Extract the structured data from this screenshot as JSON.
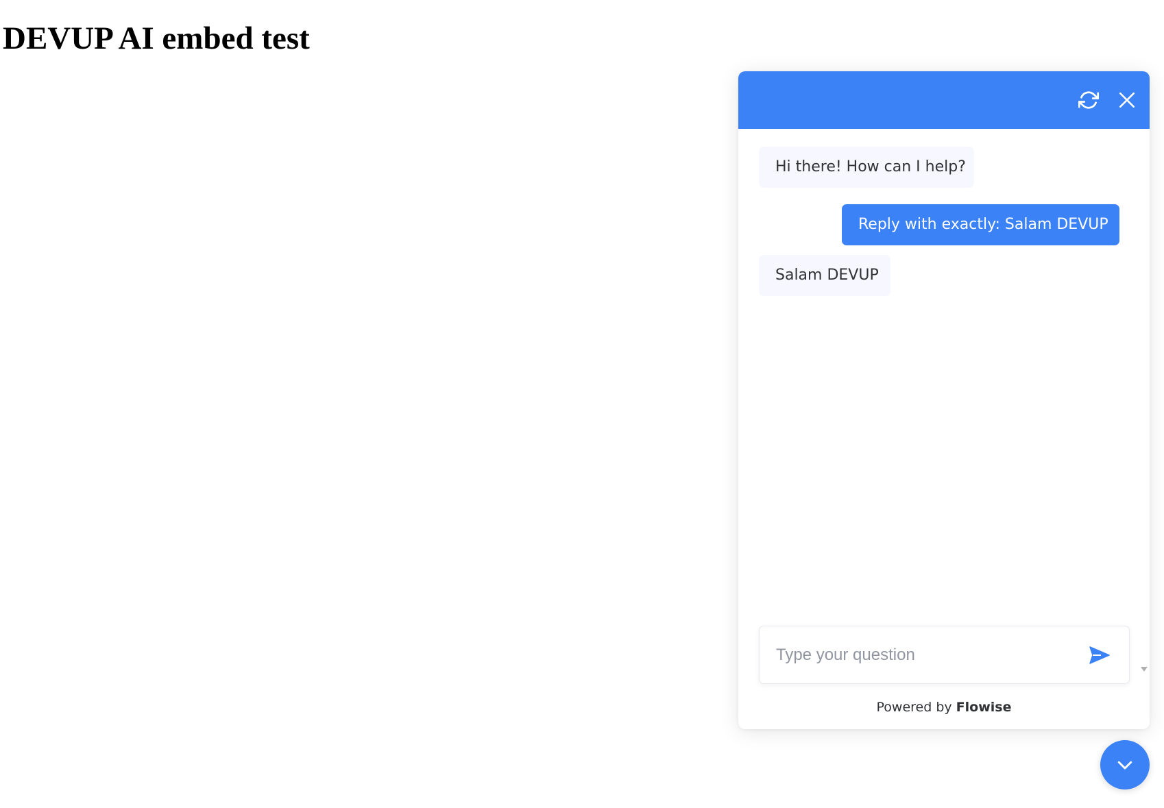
{
  "page": {
    "title": "DEVUP AI embed test"
  },
  "chatbot": {
    "header": {
      "refresh_icon": "refresh-icon",
      "close_icon": "close-icon"
    },
    "messages": [
      {
        "role": "bot",
        "text": "Hi there! How can I help?"
      },
      {
        "role": "user",
        "text": "Reply with exactly: Salam DEVUP"
      },
      {
        "role": "bot",
        "text": "Salam DEVUP"
      }
    ],
    "input": {
      "value": "",
      "placeholder": "Type your question",
      "send_icon": "send-icon"
    },
    "footer": {
      "prefix": "Powered by",
      "brand": "Flowise"
    },
    "toggle_icon": "chevron-down-icon"
  },
  "colors": {
    "accent": "#3b82f6",
    "bot_bubble_bg": "#f7f8ff",
    "bot_text": "#303235",
    "user_text": "#ffffff",
    "page_bg": "#ffffff"
  }
}
